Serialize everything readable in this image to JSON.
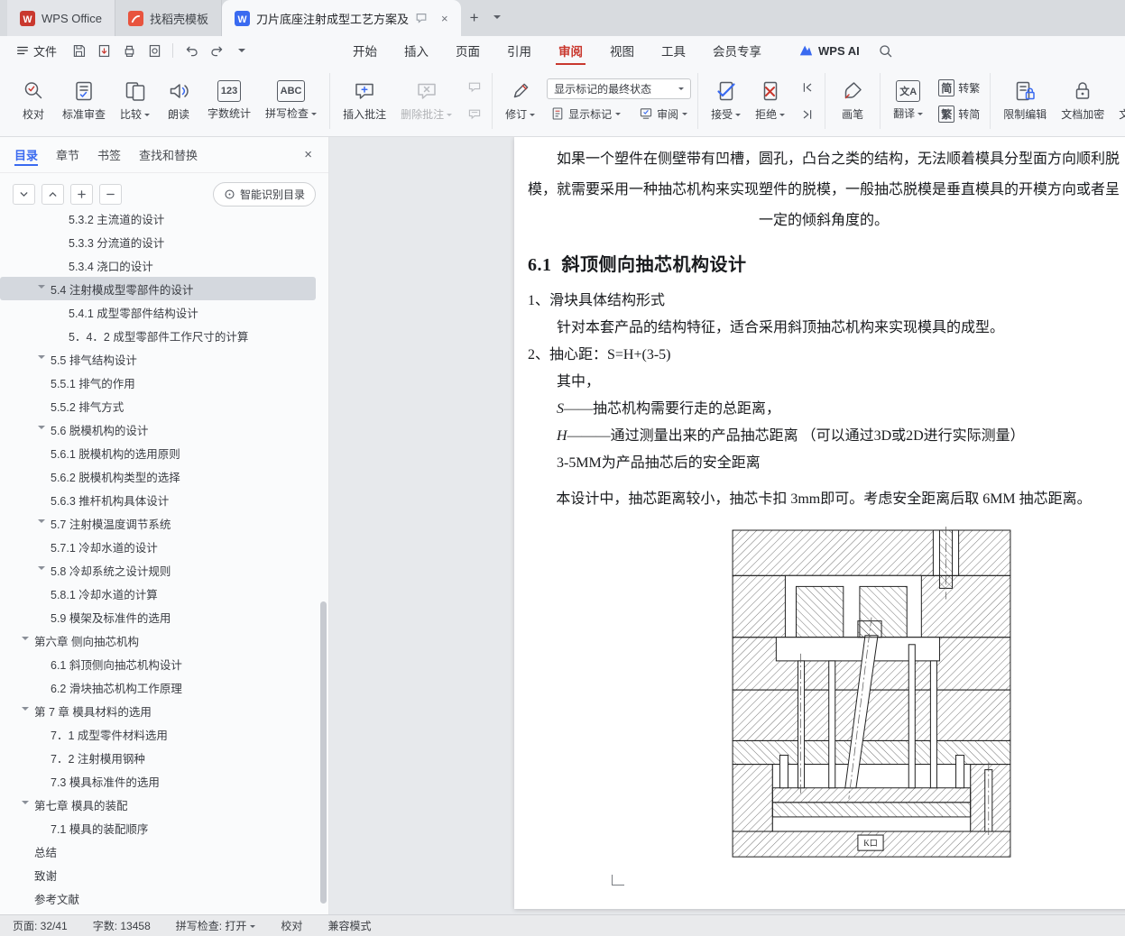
{
  "icons": {
    "wps_logo": "W",
    "doc_file": "W",
    "new_tab": "+",
    "close": "×"
  },
  "tabbar": {
    "home": "WPS Office",
    "docer": "找稻壳模板",
    "doc": "刀片底座注射成型工艺方案及"
  },
  "menubar": {
    "file": "文件",
    "tabs": [
      {
        "label": "开始"
      },
      {
        "label": "插入"
      },
      {
        "label": "页面"
      },
      {
        "label": "引用"
      },
      {
        "label": "审阅",
        "active": true
      },
      {
        "label": "视图"
      },
      {
        "label": "工具"
      },
      {
        "label": "会员专享"
      }
    ],
    "wps_ai": "WPS AI"
  },
  "ribbon": {
    "proofread": "校对",
    "standard_review": "标准审查",
    "compare": "比较",
    "read_aloud": "朗读",
    "word_count": "字数统计",
    "word_count_icon": "123",
    "spell_check": "拼写检查",
    "spell_check_icon": "ABC",
    "insert_comment": "插入批注",
    "delete_comment": "删除批注",
    "track_changes": "修订",
    "markup_state": "显示标记的最终状态",
    "show_markup": "显示标记",
    "review_menu": "审阅",
    "accept": "接受",
    "reject": "拒绝",
    "paint_pen": "画笔",
    "translate": "翻译",
    "translate_icon": "文A",
    "simp_char": "简",
    "to_trad": "转繁",
    "trad_char": "繁",
    "to_simp": "转简",
    "restrict_edit": "限制编辑",
    "encrypt": "文档加密",
    "doc_clipped": "文档定"
  },
  "sidebar": {
    "tabs": [
      {
        "label": "目录",
        "active": true
      },
      {
        "label": "章节"
      },
      {
        "label": "书签"
      },
      {
        "label": "查找和替换"
      }
    ],
    "smart_toc": "智能识别目录",
    "toc": [
      {
        "text": "5.3.2  主流道的设计",
        "level": 3,
        "clipped": true
      },
      {
        "text": "5.3.3  分流道的设计",
        "level": 3
      },
      {
        "text": "5.3.4  浇口的设计",
        "level": 3
      },
      {
        "text": "5.4  注射模成型零部件的设计",
        "level": 2,
        "expand": true,
        "selected": true
      },
      {
        "text": "5.4.1  成型零部件结构设计",
        "level": 3
      },
      {
        "text": "5．4．2  成型零部件工作尺寸的计算",
        "level": 3
      },
      {
        "text": "5.5  排气结构设计",
        "level": 2,
        "expand": true
      },
      {
        "text": "5.5.1 排气的作用",
        "level": 2
      },
      {
        "text": "5.5.2 排气方式",
        "level": 2
      },
      {
        "text": "5.6  脱模机构的设计",
        "level": 2,
        "expand": true
      },
      {
        "text": "5.6.1  脱模机构的选用原则",
        "level": 2
      },
      {
        "text": "5.6.2  脱模机构类型的选择",
        "level": 2
      },
      {
        "text": "5.6.3  推杆机构具体设计",
        "level": 2
      },
      {
        "text": "5.7 注射模温度调节系统",
        "level": 2,
        "expand": true
      },
      {
        "text": "5.7.1  冷却水道的设计",
        "level": 2
      },
      {
        "text": "5.8 冷却系统之设计规则",
        "level": 2,
        "expand": true
      },
      {
        "text": "5.8.1 冷却水道的计算",
        "level": 2
      },
      {
        "text": "5.9  模架及标准件的选用",
        "level": 2
      },
      {
        "text": "第六章 侧向抽芯机构",
        "level": 1,
        "expand": true
      },
      {
        "text": "6.1  斜顶侧向抽芯机构设计",
        "level": 2
      },
      {
        "text": "6.2 滑块抽芯机构工作原理",
        "level": 2
      },
      {
        "text": "第 7 章  模具材料的选用",
        "level": 1,
        "expand": true
      },
      {
        "text": "7．1  成型零件材料选用",
        "level": 2
      },
      {
        "text": "7．2  注射模用钢种",
        "level": 2
      },
      {
        "text": "7.3 模具标准件的选用",
        "level": 2
      },
      {
        "text": "第七章  模具的装配",
        "level": 1,
        "expand": true
      },
      {
        "text": "7.1 模具的装配顺序",
        "level": 2
      },
      {
        "text": "总结",
        "level": 1
      },
      {
        "text": "致谢",
        "level": 1
      },
      {
        "text": "参考文献",
        "level": 1
      }
    ]
  },
  "document": {
    "para1": "如果一个塑件在侧壁带有凹槽，圆孔，凸台之类的结构，无法顺着模具分型面方向顺利脱模，就需要采用一种抽芯机构来实现塑件的脱模，一般抽芯脱模是垂直模具的开模方向或者呈一定的倾斜角度的。",
    "heading": "6.1  斜顶侧向抽芯机构设计",
    "lines": [
      {
        "text": "1、滑块具体结构形式"
      },
      {
        "text": "针对本套产品的结构特征，适合采用斜顶抽芯机构来实现模具的成型。",
        "indent": 1
      },
      {
        "text": "2、抽心距：S=H+(3-5)"
      },
      {
        "text": "其中，",
        "indent": 1
      },
      {
        "lead": "S",
        "text": "——抽芯机构需要行走的总距离，",
        "indent": 1
      },
      {
        "lead": "H",
        "text": "———通过测量出来的产品抽芯距离 （可以通过3D或2D进行实际测量）",
        "indent": 1
      },
      {
        "text": "3-5MM为产品抽芯后的安全距离",
        "indent": 1
      }
    ],
    "para2": "本设计中，抽芯距离较小，抽芯卡扣 3mm即可。考虑安全距离后取 6MM 抽芯距离。",
    "figure_label": "K口"
  },
  "statusbar": {
    "page": "页面: 32/41",
    "words": "字数: 13458",
    "spell": "拼写检查: 打开",
    "proofread": "校对",
    "mode": "兼容模式"
  }
}
